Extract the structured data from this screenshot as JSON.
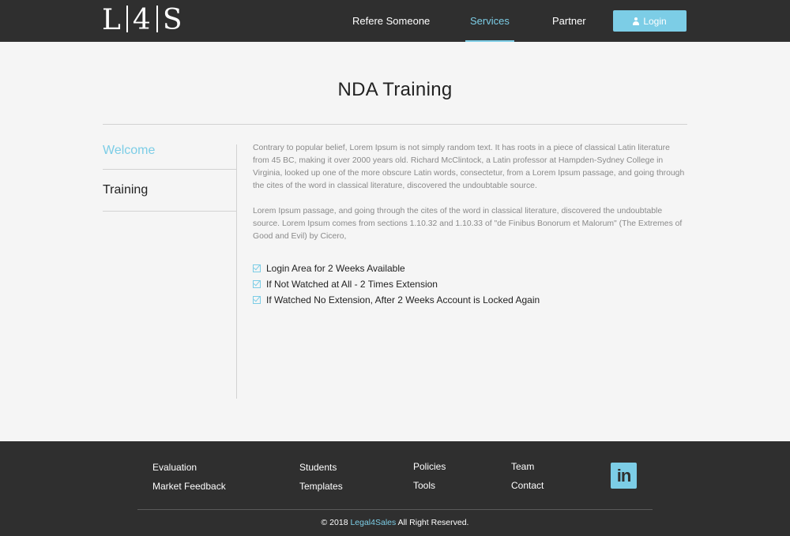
{
  "header": {
    "logo": {
      "left": "L",
      "mid": "4",
      "right": "S"
    },
    "nav": [
      {
        "label": "Refere Someone"
      },
      {
        "label": "Services"
      },
      {
        "label": "Partner"
      }
    ],
    "login_label": "Login"
  },
  "main": {
    "title": "NDA Training",
    "sidebar": [
      {
        "label": "Welcome"
      },
      {
        "label": "Training"
      }
    ],
    "paragraphs": [
      "Contrary to popular belief, Lorem Ipsum is not simply random text. It has roots in a piece of classical Latin literature from 45 BC, making it over 2000 years old. Richard McClintock, a Latin professor at Hampden-Sydney College in Virginia, looked up one of the more obscure Latin words, consectetur, from a Lorem Ipsum passage, and going through the cites of the word in classical literature, discovered the undoubtable source.",
      "Lorem Ipsum passage, and going through the cites of the word in classical literature, discovered the undoubtable source. Lorem Ipsum comes from sections 1.10.32 and 1.10.33 of \"de Finibus Bonorum et Malorum\" (The Extremes of Good and Evil) by Cicero,"
    ],
    "checklist": [
      "Login Area for 2 Weeks Available",
      "If Not Watched at All - 2 Times Extension",
      "If Watched No Extension, After 2 Weeks Account is Locked Again"
    ]
  },
  "footer": {
    "col1": [
      "Evaluation",
      "Market Feedback"
    ],
    "col2": [
      "Students",
      "Templates"
    ],
    "col3": [
      "Policies",
      "Tools"
    ],
    "col4": [
      "Team",
      "Contact"
    ],
    "linkedin_text": "in",
    "copyright_prefix": "© 2018",
    "brand": "Legal4Sales",
    "copyright_suffix": "All Right Reserved."
  },
  "colors": {
    "accent": "#7ccde6",
    "dark": "#2f2f2f",
    "background": "#f5f5f5"
  }
}
